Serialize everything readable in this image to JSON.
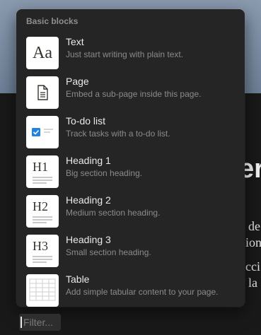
{
  "background": {
    "heading_fragment": "er",
    "text_fragments": [
      "de",
      "ion",
      "cci",
      "la"
    ]
  },
  "menu": {
    "section_title": "Basic blocks",
    "items": [
      {
        "title": "Text",
        "description": "Just start writing with plain text.",
        "icon": "text-block-icon",
        "thumb_text": "Aa"
      },
      {
        "title": "Page",
        "description": "Embed a sub-page inside this page.",
        "icon": "page-icon"
      },
      {
        "title": "To-do list",
        "description": "Track tasks with a to-do list.",
        "icon": "todo-checkbox-icon"
      },
      {
        "title": "Heading 1",
        "description": "Big section heading.",
        "icon": "heading-1-icon",
        "thumb_text": "H1"
      },
      {
        "title": "Heading 2",
        "description": "Medium section heading.",
        "icon": "heading-2-icon",
        "thumb_text": "H2"
      },
      {
        "title": "Heading 3",
        "description": "Small section heading.",
        "icon": "heading-3-icon",
        "thumb_text": "H3"
      },
      {
        "title": "Table",
        "description": "Add simple tabular content to your page.",
        "icon": "table-icon"
      }
    ]
  },
  "filter": {
    "prefix": "/",
    "placeholder": "Filter..."
  },
  "colors": {
    "menu_bg": "#252525",
    "page_bg": "#191919",
    "checkbox_accent": "#2383e2"
  }
}
